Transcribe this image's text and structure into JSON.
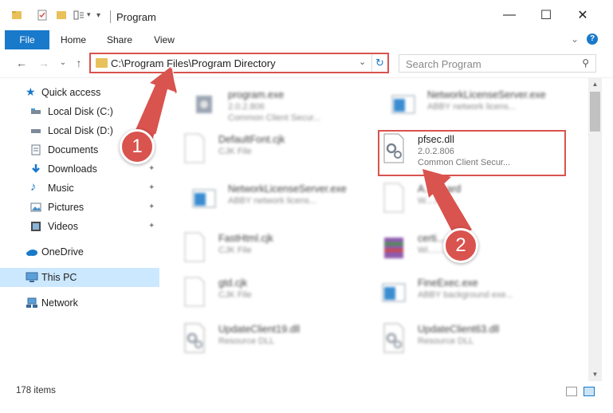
{
  "window": {
    "title": "Program",
    "minimize_glyph": "—",
    "maximize_glyph": "☐",
    "close_glyph": "✕"
  },
  "ribbon": {
    "tabs": [
      "File",
      "Home",
      "Share",
      "View"
    ],
    "expand_glyph": "⌄",
    "help_glyph": "?"
  },
  "nav": {
    "back_glyph": "←",
    "forward_glyph": "→",
    "recent_glyph": "⌄",
    "up_glyph": "↑"
  },
  "address": {
    "path": "C:\\Program Files\\Program Directory",
    "dropdown_glyph": "⌄",
    "refresh_glyph": "↻"
  },
  "search": {
    "placeholder": "Search Program",
    "icon_glyph": "⚲"
  },
  "sidebar": {
    "items": [
      {
        "label": "Quick access",
        "icon": "star-icon"
      },
      {
        "label": "Local Disk (C:)",
        "icon": "drive-icon",
        "pinned": true
      },
      {
        "label": "Local Disk (D:)",
        "icon": "drive-icon",
        "pinned": true
      },
      {
        "label": "Documents",
        "icon": "document-icon",
        "pinned": true
      },
      {
        "label": "Downloads",
        "icon": "download-icon",
        "pinned": true
      },
      {
        "label": "Music",
        "icon": "music-icon",
        "pinned": true
      },
      {
        "label": "Pictures",
        "icon": "picture-icon",
        "pinned": true
      },
      {
        "label": "Videos",
        "icon": "video-icon",
        "pinned": true
      },
      {
        "label": "OneDrive",
        "icon": "cloud-icon"
      },
      {
        "label": "This PC",
        "icon": "computer-icon",
        "selected": true
      },
      {
        "label": "Network",
        "icon": "network-icon"
      }
    ],
    "pin_glyph": "📌"
  },
  "files": [
    {
      "name": "program.exe",
      "meta1": "2.0.2.806",
      "meta2": "Common Client Secur...",
      "icon": "exe-icon"
    },
    {
      "name": "NetworkLicenseServer.exe",
      "meta1": "ABBY network licens...",
      "meta2": "",
      "icon": "window-icon"
    },
    {
      "name": "DefaultFont.cjk",
      "meta1": "CJK File",
      "meta2": "",
      "icon": "blank-file-icon"
    },
    {
      "name": "pfsec.dll",
      "meta1": "2.0.2.806",
      "meta2": "Common Client Secur...",
      "icon": "dll-icon"
    },
    {
      "name": "NetworkLicenseServer.exe",
      "meta1": "ABBY network licens...",
      "meta2": "",
      "icon": "window-icon"
    },
    {
      "name": "A........ard",
      "meta1": "W....File",
      "meta2": "",
      "icon": "blank-file-icon"
    },
    {
      "name": "FastHtml.cjk",
      "meta1": "CJK File",
      "meta2": "",
      "icon": "blank-file-icon"
    },
    {
      "name": "certi.......cab",
      "meta1": "Wi........hive",
      "meta2": "",
      "icon": "archive-icon"
    },
    {
      "name": "gtd.cjk",
      "meta1": "CJK File",
      "meta2": "",
      "icon": "blank-file-icon"
    },
    {
      "name": "FineExec.exe",
      "meta1": "ABBY background exe...",
      "meta2": "",
      "icon": "window-icon"
    },
    {
      "name": "UpdateClient19.dll",
      "meta1": "Resource DLL",
      "meta2": "",
      "icon": "dll-icon"
    },
    {
      "name": "UpdateClient63.dll",
      "meta1": "Resource DLL",
      "meta2": "",
      "icon": "dll-icon"
    }
  ],
  "status": {
    "item_count": "178 items"
  },
  "annotations": {
    "step1": "1",
    "step2": "2"
  },
  "colors": {
    "accent": "#1979ca",
    "highlight": "#d9534f",
    "selection": "#cce8ff",
    "folder": "#e8c15a"
  }
}
